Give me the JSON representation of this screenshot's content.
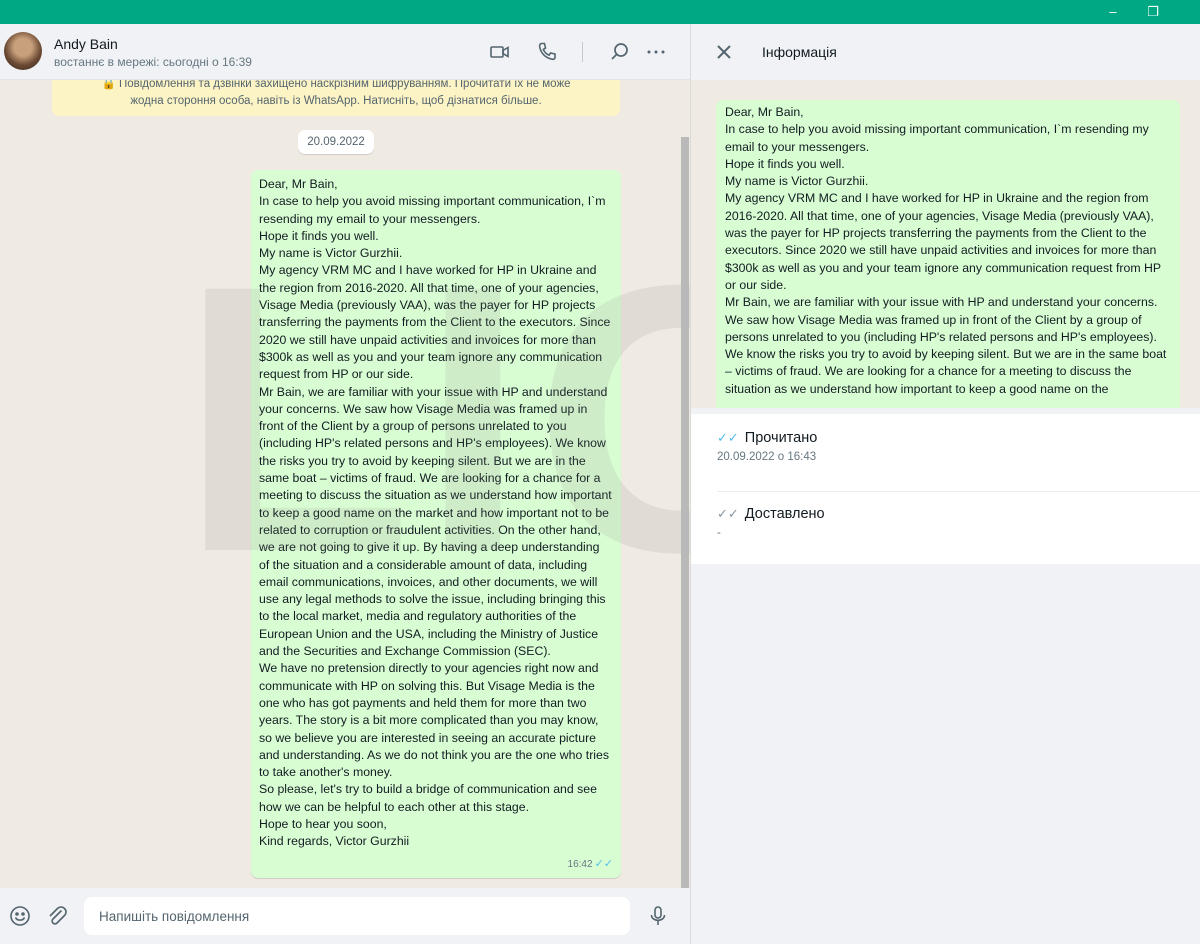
{
  "window": {
    "controls": {
      "minimize": "–",
      "maximize": "❐"
    }
  },
  "chat": {
    "contact_name": "Andy Bain",
    "contact_status": "востаннє в мережі: сьогодні о 16:39",
    "encryption_notice": "🔒 Повідомлення та дзвінки захищено наскрізним шифруванням. Прочитати їх не може\nжодна стороння особа, навіть із WhatsApp. Натисніть, щоб дізнатися більше.",
    "date_chip": "20.09.2022",
    "message": {
      "text": "Dear, Mr Bain,\nIn case to help you avoid missing important communication, I`m resending my email to your messengers.\nHope it finds you well.\nMy name is Victor Gurzhii.\nMy agency VRM MC and I have worked for HP in Ukraine and the region from 2016-2020. All that time, one of your agencies, Visage Media (previously VAA), was the payer for HP projects transferring the payments from the Client to the executors. Since 2020 we still have unpaid activities and invoices for more than $300k as well as you and your team ignore any communication request from HP or our side.\nMr Bain, we are familiar with your issue with HP and understand your concerns. We saw how Visage Media was framed up in front of the Client by a group of persons unrelated to you (including HP's related persons and HP's employees). We know the risks you try to avoid by keeping silent. But we are in the same boat – victims of fraud. We are looking for a chance for a meeting to discuss the situation as we understand how important to keep a good name on the market and how important not to be related to corruption or fraudulent activities. On the other hand, we are not going to give it up. By having a deep understanding of the situation and a considerable amount of data, including email communications, invoices, and other documents, we will use any legal methods to solve the issue, including bringing this to the local market, media and regulatory authorities of the European Union and the USA, including the Ministry of Justice and the Securities and Exchange Commission (SEC).\nWe have no pretension directly to your agencies right now and communicate with HP on solving this. But Visage Media is the one who has got payments and held them for more than two years. The story is a bit more complicated than you may know, so we believe you are interested in seeing an accurate picture and understanding. As we do not think you are the one who tries to take another's money.\nSo please, let's try to build a bridge of communication and see how we can be helpful to each other at this stage.\nHope to hear you soon,\nKind regards, Victor Gurzhii",
      "time": "16:42",
      "ticks": "✓✓"
    },
    "watermark": "LIGA"
  },
  "composer": {
    "placeholder": "Напишіть повідомлення"
  },
  "info_panel": {
    "title": "Інформація",
    "preview_text": "Dear, Mr Bain,\nIn case to help you avoid missing important communication, I`m resending my email to your messengers.\nHope it finds you well.\nMy name is Victor Gurzhii.\nMy agency VRM MC and I have worked for HP in Ukraine and the region from 2016-2020. All that time, one of your agencies, Visage Media (previously VAA), was the payer for HP projects transferring the payments from the Client to the executors. Since 2020 we still have unpaid activities and invoices for more than $300k as well as you and your team ignore any communication request from HP or our side.\nMr Bain, we are familiar with your issue with HP and understand your concerns. We saw how Visage Media was framed up in front of the Client by a group of persons unrelated to you (including HP's related persons and HP's employees). We know the risks you try to avoid by keeping silent. But we are in the same boat – victims of fraud. We are looking for a chance for a meeting to discuss the situation as we understand how important to keep a good name on the",
    "read_label": "Прочитано",
    "read_time": "20.09.2022 о 16:43",
    "read_ticks": "✓✓",
    "delivered_label": "Доставлено",
    "delivered_time": "-",
    "delivered_ticks": "✓✓"
  },
  "colors": {
    "accent": "#00a884",
    "outgoing_bubble": "#d9fdd3",
    "read_ticks": "#53bdeb",
    "delivered_ticks": "#8696a0"
  }
}
